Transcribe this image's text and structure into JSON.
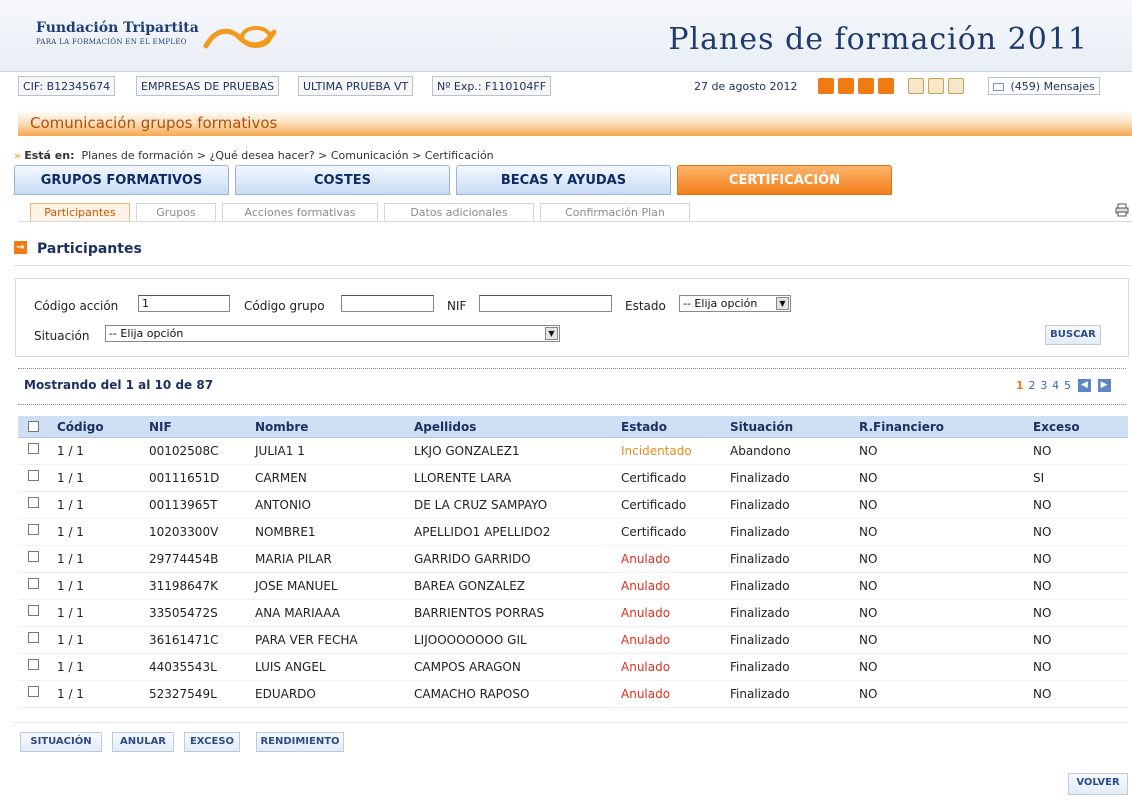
{
  "header": {
    "logo_name": "Fundación Tripartita",
    "logo_sub": "PARA LA FORMACIÓN EN EL EMPLEO",
    "app_title": "Planes de formación 2011"
  },
  "infobar": {
    "cif": "CIF: B12345674",
    "company": "EMPRESAS DE PRUEBAS",
    "last": "ULTIMA PRUEBA VT",
    "exp": "Nº Exp.: F110104FF",
    "date": "27 de agosto 2012",
    "messages": "(459) Mensajes",
    "icons": [
      "exit-icon",
      "help-icon",
      "home-icon",
      "copy-icon",
      "print-icon",
      "chart-icon",
      "edit-icon",
      "mail-icon"
    ]
  },
  "section": {
    "title": "Comunicación grupos formativos"
  },
  "breadcrumb": {
    "lead": "Está en:",
    "path": "Planes de formación > ¿Qué desea hacer? > Comunicación > Certificación"
  },
  "main_tabs": [
    "GRUPOS FORMATIVOS",
    "COSTES",
    "BECAS Y AYUDAS",
    "CERTIFICACIÓN"
  ],
  "sub_tabs": [
    "Participantes",
    "Grupos",
    "Acciones formativas",
    "Datos adicionales",
    "Confirmación Plan"
  ],
  "panel": {
    "title": "Participantes"
  },
  "filters": {
    "codigo_accion_label": "Código acción",
    "codigo_accion_value": "1",
    "codigo_grupo_label": "Código grupo",
    "codigo_grupo_value": "",
    "nif_label": "NIF",
    "nif_value": "",
    "estado_label": "Estado",
    "estado_value": "-- Elija opción",
    "situacion_label": "Situación",
    "situacion_value": "-- Elija opción",
    "search_button": "BUSCAR"
  },
  "results": {
    "showing": "Mostrando del 1 al 10 de 87",
    "pages": [
      "1",
      "2",
      "3",
      "4",
      "5"
    ],
    "current_page": "1"
  },
  "table": {
    "columns": [
      "Código",
      "NIF",
      "Nombre",
      "Apellidos",
      "Estado",
      "Situación",
      "R.Financiero",
      "Exceso"
    ],
    "rows": [
      {
        "codigo": "1 / 1",
        "nif": "00102508C",
        "nombre": "JULIA1 1",
        "apellidos": "LKJO GONZALEZ1",
        "estado": "Incidentado",
        "situacion": "Abandono",
        "rf": "NO",
        "exceso": "NO"
      },
      {
        "codigo": "1 / 1",
        "nif": "00111651D",
        "nombre": "CARMEN",
        "apellidos": "LLORENTE LARA",
        "estado": "Certificado",
        "situacion": "Finalizado",
        "rf": "NO",
        "exceso": "SI"
      },
      {
        "codigo": "1 / 1",
        "nif": "00113965T",
        "nombre": "ANTONIO",
        "apellidos": "DE LA CRUZ SAMPAYO",
        "estado": "Certificado",
        "situacion": "Finalizado",
        "rf": "NO",
        "exceso": "NO"
      },
      {
        "codigo": "1 / 1",
        "nif": "10203300V",
        "nombre": "NOMBRE1",
        "apellidos": "APELLIDO1 APELLIDO2",
        "estado": "Certificado",
        "situacion": "Finalizado",
        "rf": "NO",
        "exceso": "NO"
      },
      {
        "codigo": "1 / 1",
        "nif": "29774454B",
        "nombre": "MARIA PILAR",
        "apellidos": "GARRIDO GARRIDO",
        "estado": "Anulado",
        "situacion": "Finalizado",
        "rf": "NO",
        "exceso": "NO"
      },
      {
        "codigo": "1 / 1",
        "nif": "31198647K",
        "nombre": "JOSE MANUEL",
        "apellidos": "BAREA GONZALEZ",
        "estado": "Anulado",
        "situacion": "Finalizado",
        "rf": "NO",
        "exceso": "NO"
      },
      {
        "codigo": "1 / 1",
        "nif": "33505472S",
        "nombre": "ANA MARIAAA",
        "apellidos": "BARRIENTOS PORRAS",
        "estado": "Anulado",
        "situacion": "Finalizado",
        "rf": "NO",
        "exceso": "NO"
      },
      {
        "codigo": "1 / 1",
        "nif": "36161471C",
        "nombre": "PARA VER FECHA",
        "apellidos": "LIJOOOOOOOO GIL",
        "estado": "Anulado",
        "situacion": "Finalizado",
        "rf": "NO",
        "exceso": "NO"
      },
      {
        "codigo": "1 / 1",
        "nif": "44035543L",
        "nombre": "LUIS ANGEL",
        "apellidos": "CAMPOS ARAGON",
        "estado": "Anulado",
        "situacion": "Finalizado",
        "rf": "NO",
        "exceso": "NO"
      },
      {
        "codigo": "1 / 1",
        "nif": "52327549L",
        "nombre": "EDUARDO",
        "apellidos": "CAMACHO RAPOSO",
        "estado": "Anulado",
        "situacion": "Finalizado",
        "rf": "NO",
        "exceso": "NO"
      }
    ]
  },
  "actions": [
    "SITUACIÓN",
    "ANULAR",
    "EXCESO",
    "RENDIMIENTO"
  ],
  "volver": "VOLVER",
  "colors": {
    "accent_orange": "#f47f1c",
    "navy": "#1c3161",
    "anulado": "#e0301e",
    "incidentado": "#e48e1e"
  }
}
